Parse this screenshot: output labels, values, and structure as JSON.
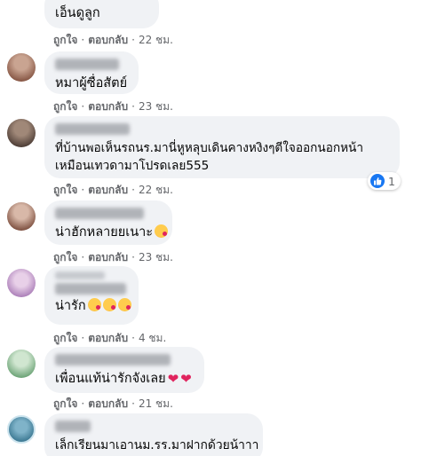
{
  "comments": [
    {
      "author": "",
      "text": "เอ็นดูลูก",
      "like_label": "ถูกใจ",
      "reply_label": "ตอบกลับ",
      "time": "22 ชม."
    },
    {
      "author": "",
      "text": "หมาผู้ซื่อสัตย์",
      "like_label": "ถูกใจ",
      "reply_label": "ตอบกลับ",
      "time": "23 ชม."
    },
    {
      "author": "",
      "text_line1": "ที่บ้านพอเห็นรถนร.มานี่หูหลุบเดินคางหงิงๆตีใจออกนอกหน้า",
      "text_line2": "เหมือนเทวดามาโปรดเลย555",
      "like_label": "ถูกใจ",
      "reply_label": "ตอบกลับ",
      "time": "22 ชม.",
      "reaction_count": "1"
    },
    {
      "author": "",
      "text": "น่าฮักหลายยเนาะ",
      "like_label": "ถูกใจ",
      "reply_label": "ตอบกลับ",
      "time": "23 ชม."
    },
    {
      "author": "",
      "text": "น่ารัก",
      "like_label": "ถูกใจ",
      "reply_label": "ตอบกลับ",
      "time": "4 ชม."
    },
    {
      "author": "",
      "text": "เพื่อนแท้น่ารักจังเลย",
      "like_label": "ถูกใจ",
      "reply_label": "ตอบกลับ",
      "time": "21 ชม."
    },
    {
      "author": "",
      "text": "เล็กเรียนมาเอานม.รร.มาฝากด้วยน้าาา"
    }
  ],
  "separator": "·",
  "colors": {
    "bubble": "#f0f2f5",
    "meta": "#65676b",
    "like_blue": "#1877f2"
  }
}
